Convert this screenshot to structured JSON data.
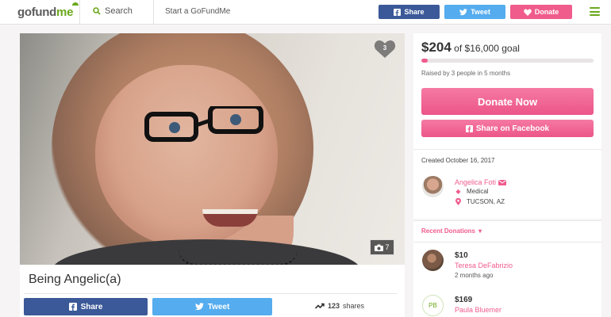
{
  "header": {
    "logo": {
      "part1": "go",
      "part2": "fund",
      "part3": "me"
    },
    "search_label": "Search",
    "start_label": "Start a GoFundMe",
    "share_label": "Share",
    "tweet_label": "Tweet",
    "donate_label": "Donate",
    "icons": {
      "search": "search-icon",
      "facebook": "facebook-icon",
      "twitter": "twitter-icon",
      "heart": "heart-icon",
      "menu": "menu-icon"
    }
  },
  "campaign": {
    "title": "Being Angelic(a)",
    "heart_count": "3",
    "photo_count": "7",
    "share_label": "Share",
    "tweet_label": "Tweet",
    "shares_count": "123",
    "shares_label": "shares"
  },
  "funding": {
    "raised": "$204",
    "goal_text": "of $16,000 goal",
    "progress_fraction": 0.0128,
    "raised_by": "Raised by 3 people in 5 months",
    "donate_now": "Donate Now",
    "share_facebook": "Share on Facebook"
  },
  "organizer": {
    "created": "Created October 16, 2017",
    "name": "Angelica Foti",
    "category": "Medical",
    "location": "TUCSON, AZ"
  },
  "recent": {
    "header": "Recent Donations",
    "donations": [
      {
        "amount": "$10",
        "name": "Teresa DeFabrizio",
        "time": "2 months ago",
        "initials": ""
      },
      {
        "amount": "$169",
        "name": "Paula Bluemer",
        "time": "",
        "initials": "PB"
      }
    ]
  },
  "colors": {
    "accent": "#f05c8c",
    "brand_green": "#6aa81c",
    "facebook": "#3b5998",
    "twitter": "#55acee"
  }
}
